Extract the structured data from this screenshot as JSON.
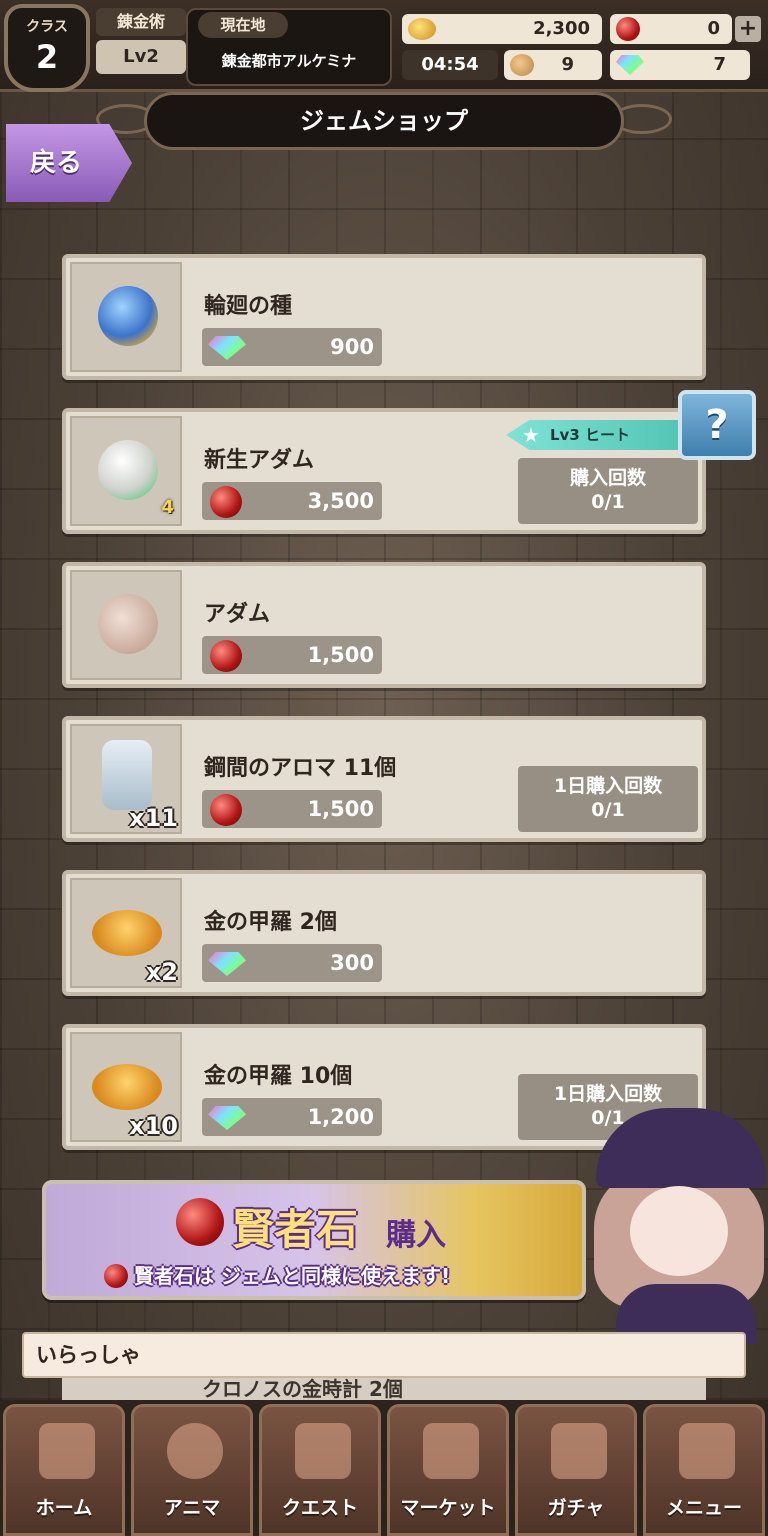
{
  "header": {
    "class_label": "クラス",
    "class_value": "2",
    "alchemy_label": "錬金術",
    "alchemy_level": "Lv2",
    "location_label": "現在地",
    "location_name": "錬金都市アルケミナ",
    "coins": "2,300",
    "rubies": "0",
    "timer": "04:54",
    "cookies": "9",
    "gems": "7",
    "plus_label": "+"
  },
  "title": "ジェムショップ",
  "back_label": "戻る",
  "help_label": "?",
  "items": [
    {
      "name": "輪廻の種",
      "currency": "gem",
      "price": "900",
      "qty": "",
      "limit": ""
    },
    {
      "name": "新生アダム",
      "currency": "ruby",
      "price": "3,500",
      "qty": "",
      "level_digit": "4",
      "tag": "Lv3 ヒート",
      "limit_label": "購入回数",
      "limit_value": "0/1"
    },
    {
      "name": "アダム",
      "currency": "ruby",
      "price": "1,500",
      "qty": "",
      "limit": ""
    },
    {
      "name": "鋼間のアロマ 11個",
      "currency": "ruby",
      "price": "1,500",
      "qty": "x11",
      "limit_label": "1日購入回数",
      "limit_value": "0/1"
    },
    {
      "name": "金の甲羅 2個",
      "currency": "gem",
      "price": "300",
      "qty": "x2",
      "limit": ""
    },
    {
      "name": "金の甲羅 10個",
      "currency": "gem",
      "price": "1,200",
      "qty": "x10",
      "limit_label": "1日購入回数",
      "limit_value": "0/1"
    }
  ],
  "banner": {
    "title_main": "賢者石",
    "title_sub": "購入",
    "subtitle": "賢者石は ジェムと同様に使えます!"
  },
  "dialogue": "いらっしゃ",
  "partial_item": "クロノスの金時計 2個",
  "nav": [
    {
      "label": "ホーム",
      "icon": "carriage-icon"
    },
    {
      "label": "アニマ",
      "icon": "anima-icon"
    },
    {
      "label": "クエスト",
      "icon": "quest-map-icon"
    },
    {
      "label": "マーケット",
      "icon": "market-icon"
    },
    {
      "label": "ガチャ",
      "icon": "gacha-chest-icon"
    },
    {
      "label": "メニュー",
      "icon": "menu-grid-icon"
    }
  ],
  "colors": {
    "accent_purple": "#8a5bb6",
    "teal_tag": "#4ec1b1",
    "help_blue": "#3f7fad"
  }
}
